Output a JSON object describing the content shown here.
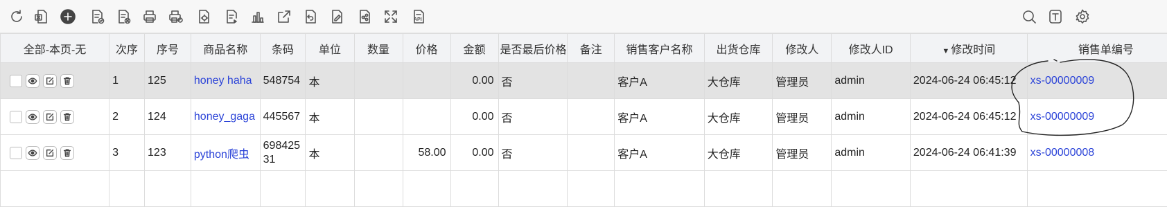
{
  "toolbar": {
    "icons": [
      "refresh-icon",
      "export-excel-icon",
      "add-icon",
      "approve-icon",
      "unapprove-icon",
      "print-icon",
      "print-preview-icon",
      "print-settings-icon",
      "import-icon",
      "chart-icon",
      "share-out-icon",
      "undo-icon",
      "edit-doc-icon",
      "share-icon",
      "fullscreen-icon",
      "api-icon"
    ],
    "right_icons": [
      "search-icon",
      "text-format-icon",
      "settings-icon"
    ],
    "api_label": "API"
  },
  "table": {
    "headers": {
      "select": "全部-本页-无",
      "index": "次序",
      "seq": "序号",
      "product": "商品名称",
      "barcode": "条码",
      "unit": "单位",
      "qty": "数量",
      "price": "价格",
      "amount": "金额",
      "last_price": "是否最后价格",
      "remark": "备注",
      "customer": "销售客户名称",
      "warehouse": "出货仓库",
      "modifier": "修改人",
      "modifier_id": "修改人ID",
      "modified_time": "修改时间",
      "order_no": "销售单编号"
    },
    "sort_indicator": "▼",
    "rows": [
      {
        "index": "1",
        "seq": "125",
        "product": "honey haha",
        "barcode": "548754",
        "unit": "本",
        "qty": "",
        "price": "",
        "amount": "0.00",
        "last_price": "否",
        "remark": "",
        "customer": "客户A",
        "warehouse": "大仓库",
        "modifier": "管理员",
        "modifier_id": "admin",
        "modified_time": "2024-06-24 06:45:12",
        "order_no": "xs-00000009"
      },
      {
        "index": "2",
        "seq": "124",
        "product": "honey_gaga",
        "barcode": "445567",
        "unit": "本",
        "qty": "",
        "price": "",
        "amount": "0.00",
        "last_price": "否",
        "remark": "",
        "customer": "客户A",
        "warehouse": "大仓库",
        "modifier": "管理员",
        "modifier_id": "admin",
        "modified_time": "2024-06-24 06:45:12",
        "order_no": "xs-00000009"
      },
      {
        "index": "3",
        "seq": "123",
        "product": "python爬虫",
        "barcode": "69842531",
        "unit": "本",
        "qty": "",
        "price": "58.00",
        "amount": "0.00",
        "last_price": "否",
        "remark": "",
        "customer": "客户A",
        "warehouse": "大仓库",
        "modifier": "管理员",
        "modifier_id": "admin",
        "modified_time": "2024-06-24 06:41:39",
        "order_no": "xs-00000008"
      }
    ]
  }
}
